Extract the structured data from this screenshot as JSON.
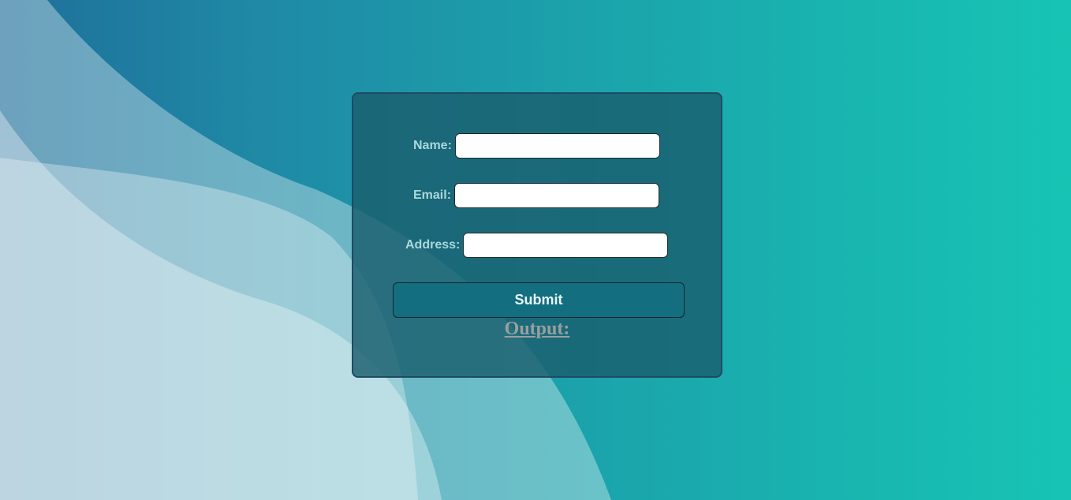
{
  "form": {
    "name_label": "Name:",
    "name_value": "",
    "email_label": "Email:",
    "email_value": "",
    "address_label": "Address:",
    "address_value": "",
    "submit_label": "Submit",
    "output_label": "Output:"
  },
  "colors": {
    "background_start": "#1f6f9a",
    "background_end": "#17c4b4",
    "card": "#1a5e6e",
    "submit_button": "#136f7f",
    "label_text": "#a9d8dc",
    "output_text": "#9a9fa0"
  }
}
